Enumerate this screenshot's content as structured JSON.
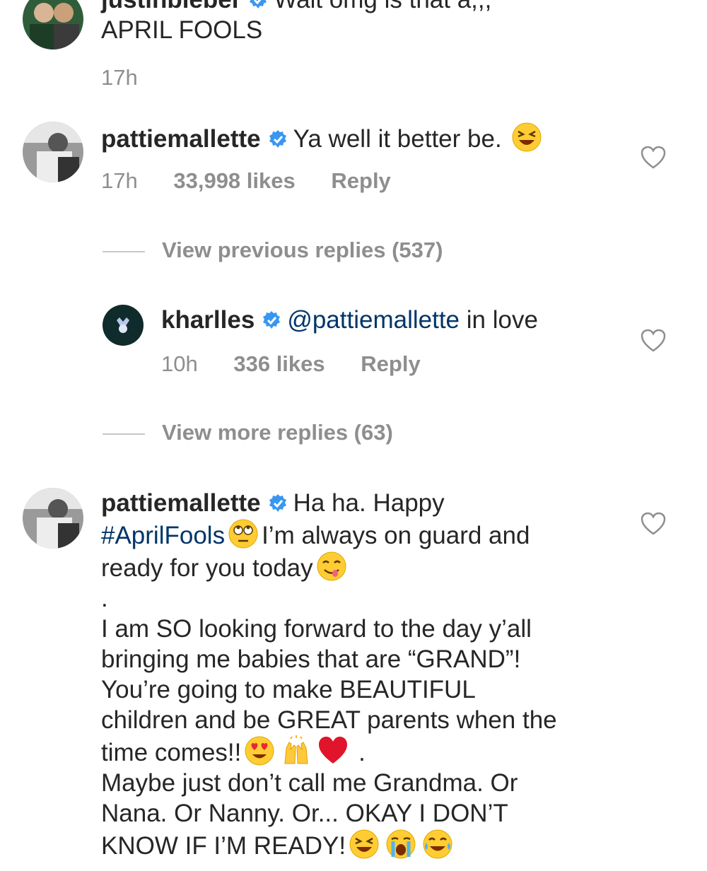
{
  "comments": [
    {
      "username": "justinbieber",
      "text": "Wait omg is that a,,,",
      "text_line2": "APRIL FOOLS",
      "time": "17h"
    },
    {
      "username": "pattiemallette",
      "text": "Ya well it better be.",
      "emoji": "laughing-emoji",
      "time": "17h",
      "likes": "33,998 likes",
      "reply": "Reply"
    },
    {
      "view_previous": "View previous replies (537)",
      "reply_username": "kharlles",
      "mention": "@pattiemallette",
      "reply_text": "in love",
      "time": "10h",
      "likes": "336 likes",
      "reply": "Reply",
      "view_more": "View more replies (63)"
    },
    {
      "username": "pattiemallette",
      "line1": "Ha ha. Happy",
      "hashtag": "#AprilFools",
      "line2_rest": "I’m always on guard and",
      "line3": "ready for you today",
      "dot": ".",
      "para_lines": [
        "I am SO looking forward to the day y’all",
        "bringing me babies that are “GRAND”!",
        "You’re going to make BEAUTIFUL",
        "children and be GREAT parents when the",
        "time comes!!"
      ],
      "trailing_dot": ".",
      "final_lines": [
        "Maybe just don’t call me Grandma. Or",
        "Nana. Or Nanny. Or... OKAY I DON’T",
        "KNOW IF I’M READY!"
      ]
    }
  ],
  "colors": {
    "text": "#262626",
    "muted": "#8e8e8e",
    "link": "#003569",
    "verified": "#3897f0"
  }
}
